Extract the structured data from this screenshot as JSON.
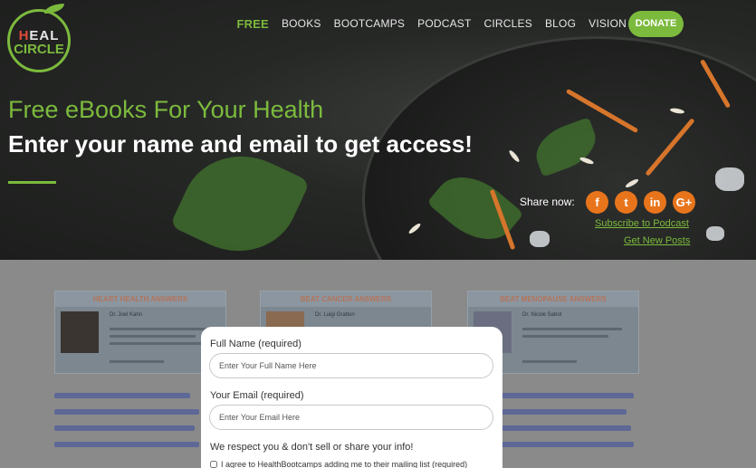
{
  "brand": {
    "logo_line1_h": "H",
    "logo_line1_rest": "EAL",
    "logo_line2": "CIRCLE"
  },
  "nav": {
    "items": [
      "FREE",
      "BOOKS",
      "BOOTCAMPS",
      "PODCAST",
      "CIRCLES",
      "BLOG",
      "VISION"
    ],
    "donate": "DONATE"
  },
  "hero": {
    "title": "Free eBooks For Your Health",
    "subtitle": "Enter your name and email to get access!",
    "share_label": "Share now:",
    "social": [
      {
        "icon": "facebook-icon",
        "glyph": "f"
      },
      {
        "icon": "twitter-icon",
        "glyph": "t"
      },
      {
        "icon": "linkedin-icon",
        "glyph": "in"
      },
      {
        "icon": "google-plus-icon",
        "glyph": "G+"
      }
    ],
    "subscribe_link": "Subscribe to Podcast",
    "new_posts_link": "Get New Posts"
  },
  "cards": [
    {
      "head": "HEART HEALTH ANSWERS",
      "name": "Dr. Joel Kahn"
    },
    {
      "head": "BEAT CANCER ANSWERS",
      "name": "Dr. Luigi Gratton"
    },
    {
      "head": "BEAT MENOPAUSE ANSWERS",
      "name": "Dr. Nicole Sabot"
    }
  ],
  "modal": {
    "name_label": "Full Name (required)",
    "name_placeholder": "Enter Your Full Name Here",
    "email_label": "Your Email (required)",
    "email_placeholder": "Enter Your Email Here",
    "respect": "We respect you & don't sell or share your info!",
    "agree": "I agree to HealthBootcamps adding me to their mailing list (required)"
  },
  "colors": {
    "accent": "#7cba3d",
    "social": "#e8751c",
    "dim": "#8a8a8a"
  }
}
